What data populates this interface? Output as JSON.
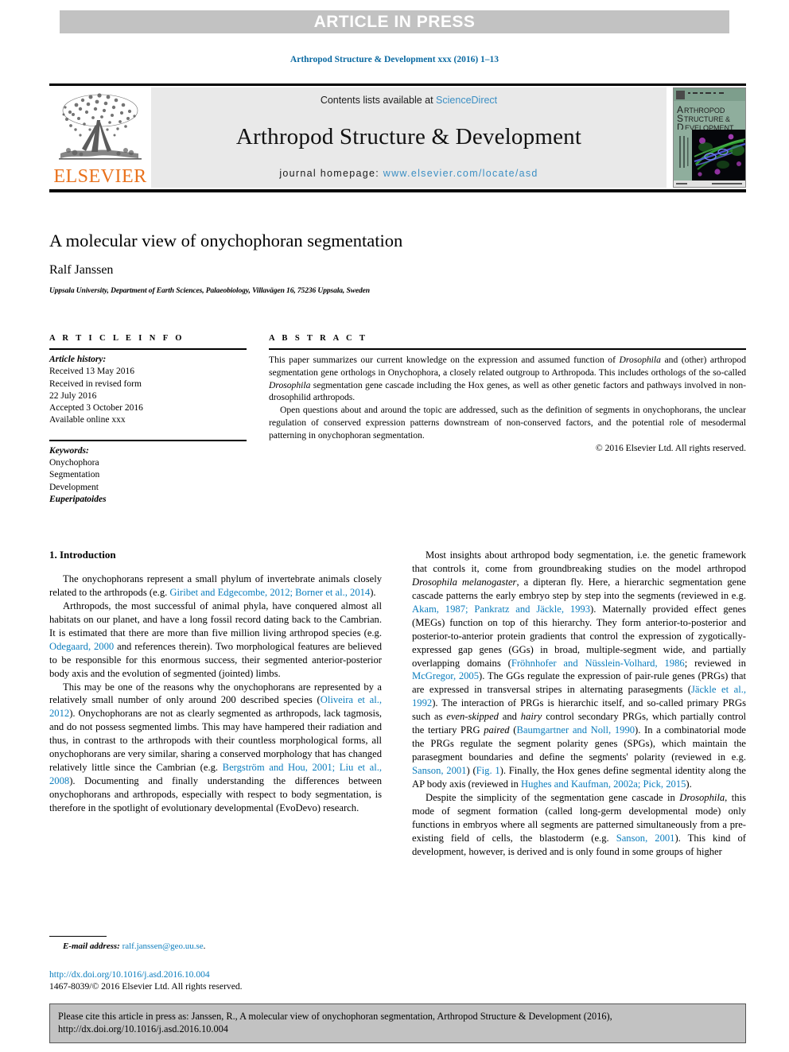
{
  "banner": {
    "text": "ARTICLE IN PRESS"
  },
  "running_head": "Arthropod Structure & Development xxx (2016) 1–13",
  "masthead": {
    "contents_prefix": "Contents lists available at ",
    "sciencedirect": "ScienceDirect",
    "journal_title": "Arthropod Structure & Development",
    "homepage_prefix": "journal homepage: ",
    "homepage_url": "www.elsevier.com/locate/asd",
    "publisher_wordmark": "ELSEVIER",
    "publisher_logo_name": "elsevier-tree-logo",
    "cover_lines": [
      "ARTHROPOD",
      "STRUCTURE &",
      "DEVELOPMENT"
    ],
    "accent_orange": "#E9711C",
    "link_blue": "#3c8fc4"
  },
  "article": {
    "title": "A molecular view of onychophoran segmentation",
    "author": "Ralf Janssen",
    "affiliation": "Uppsala University, Department of Earth Sciences, Palaeobiology, Villavägen 16, 75236 Uppsala, Sweden"
  },
  "article_info": {
    "heading": "A R T I C L E   I N F O",
    "history_label": "Article history:",
    "history": [
      "Received 13 May 2016",
      "Received in revised form",
      "22 July 2016",
      "Accepted 3 October 2016",
      "Available online xxx"
    ],
    "keywords_label": "Keywords:",
    "keywords": [
      "Onychophora",
      "Segmentation",
      "Development",
      "Euperipatoides"
    ],
    "keywords_italic_index": 3
  },
  "abstract": {
    "heading": "A B S T R A C T",
    "paragraph1_a": "This paper summarizes our current knowledge on the expression and assumed function of ",
    "paragraph1_dros1": "Drosophila",
    "paragraph1_b": " and (other) arthropod segmentation gene orthologs in Onychophora, a closely related outgroup to Arthropoda. This includes orthologs of the so-called ",
    "paragraph1_dros2": "Drosophila",
    "paragraph1_c": " segmentation gene cascade including the Hox genes, as well as other genetic factors and pathways involved in non-drosophilid arthropods.",
    "paragraph2": "Open questions about and around the topic are addressed, such as the definition of segments in onychophorans, the unclear regulation of conserved expression patterns downstream of non-conserved factors, and the potential role of mesodermal patterning in onychophoran segmentation.",
    "copyright": "© 2016 Elsevier Ltd. All rights reserved."
  },
  "body": {
    "section_heading": "1. Introduction",
    "left_paragraphs": [
      {
        "runs": [
          {
            "t": "The onychophorans represent a small phylum of invertebrate animals closely related to the arthropods (e.g. "
          },
          {
            "t": "Giribet and Edgecombe, 2012; Borner et al., 2014",
            "style": "ref"
          },
          {
            "t": ")."
          }
        ]
      },
      {
        "runs": [
          {
            "t": "Arthropods, the most successful of animal phyla, have conquered almost all habitats on our planet, and have a long fossil record dating back to the Cambrian. It is estimated that there are more than five million living arthropod species (e.g. "
          },
          {
            "t": "Odegaard, 2000",
            "style": "ref"
          },
          {
            "t": " and references therein). Two morphological features are believed to be responsible for this enormous success, their segmented anterior-posterior body axis and the evolution of segmented (jointed) limbs."
          }
        ]
      },
      {
        "runs": [
          {
            "t": "This may be one of the reasons why the onychophorans are represented by a relatively small number of only around 200 described species ("
          },
          {
            "t": "Oliveira et al., 2012",
            "style": "ref"
          },
          {
            "t": "). Onychophorans are not as clearly segmented as arthropods, lack tagmosis, and do not possess segmented limbs. This may have hampered their radiation and thus, in contrast to the arthropods with their countless morphological forms, all onychophorans are very similar, sharing a conserved morphology that has changed relatively little since the Cambrian (e.g. "
          },
          {
            "t": "Bergström and Hou, 2001; Liu et al., 2008",
            "style": "ref"
          },
          {
            "t": "). Documenting and finally understanding the differences between onychophorans and arthropods, especially with respect to body segmentation, is therefore in the spotlight of evolutionary developmental (EvoDevo) research."
          }
        ]
      }
    ],
    "right_paragraphs": [
      {
        "runs": [
          {
            "t": "Most insights about arthropod body segmentation, i.e. the genetic framework that controls it, come from groundbreaking studies on the model arthropod "
          },
          {
            "t": "Drosophila melanogaster",
            "style": "ital"
          },
          {
            "t": ", a dipteran fly. Here, a hierarchic segmentation gene cascade patterns the early embryo step by step into the segments (reviewed in e.g. "
          },
          {
            "t": "Akam, 1987; Pankratz and Jäckle, 1993",
            "style": "ref"
          },
          {
            "t": "). Maternally provided effect genes (MEGs) function on top of this hierarchy. They form anterior-to-posterior and posterior-to-anterior protein gradients that control the expression of zygotically-expressed gap genes (GGs) in broad, multiple-segment wide, and partially overlapping domains ("
          },
          {
            "t": "Fröhnhofer and Nüsslein-Volhard, 1986",
            "style": "ref"
          },
          {
            "t": "; reviewed in "
          },
          {
            "t": "McGregor, 2005",
            "style": "ref"
          },
          {
            "t": "). The GGs regulate the expression of pair-rule genes (PRGs) that are expressed in transversal stripes in alternating parasegments ("
          },
          {
            "t": "Jäckle et al., 1992",
            "style": "ref"
          },
          {
            "t": "). The interaction of PRGs is hierarchic itself, and so-called primary PRGs such as "
          },
          {
            "t": "even-skipped",
            "style": "ital"
          },
          {
            "t": " and "
          },
          {
            "t": "hairy",
            "style": "ital"
          },
          {
            "t": " control secondary PRGs, which partially control the tertiary PRG "
          },
          {
            "t": "paired",
            "style": "ital"
          },
          {
            "t": " ("
          },
          {
            "t": "Baumgartner and Noll, 1990",
            "style": "ref"
          },
          {
            "t": "). In a combinatorial mode the PRGs regulate the segment polarity genes (SPGs), which maintain the parasegment boundaries and define the segments' polarity (reviewed in e.g. "
          },
          {
            "t": "Sanson, 2001",
            "style": "ref"
          },
          {
            "t": ") ("
          },
          {
            "t": "Fig. 1",
            "style": "ref"
          },
          {
            "t": "). Finally, the Hox genes define segmental identity along the AP body axis (reviewed in "
          },
          {
            "t": "Hughes and Kaufman, 2002a; Pick, 2015",
            "style": "ref"
          },
          {
            "t": ")."
          }
        ]
      },
      {
        "runs": [
          {
            "t": "Despite the simplicity of the segmentation gene cascade in "
          },
          {
            "t": "Drosophila",
            "style": "ital"
          },
          {
            "t": ", this mode of segment formation (called long-germ developmental mode) only functions in embryos where all segments are patterned simultaneously from a pre-existing field of cells, the blastoderm (e.g. "
          },
          {
            "t": "Sanson, 2001",
            "style": "ref"
          },
          {
            "t": "). This kind of development, however, is derived and is only found in some groups of higher"
          }
        ]
      }
    ]
  },
  "footer": {
    "email_label": "E-mail address:",
    "email": "ralf.janssen@geo.uu.se",
    "email_suffix": ".",
    "doi": "http://dx.doi.org/10.1016/j.asd.2016.10.004",
    "issn_line": "1467-8039/© 2016 Elsevier Ltd. All rights reserved.",
    "ref_color": "#0b7dbd"
  },
  "cite_box": {
    "line1": "Please cite this article in press as: Janssen, R., A molecular view of onychophoran segmentation, Arthropod Structure & Development (2016),",
    "line2": "http://dx.doi.org/10.1016/j.asd.2016.10.004"
  }
}
